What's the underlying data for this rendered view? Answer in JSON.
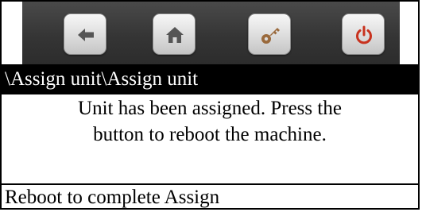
{
  "toolbar": {
    "buttons": [
      {
        "icon": "back-arrow-icon"
      },
      {
        "icon": "home-icon"
      },
      {
        "icon": "key-icon"
      },
      {
        "icon": "power-icon"
      }
    ],
    "background_color": "#353535",
    "button_color": "#dcdcdc",
    "icon_color": "#555555",
    "key_icon_color": "#9a6a3c",
    "power_icon_color": "#c8321e"
  },
  "path": {
    "text": "\\Assign unit\\Assign unit",
    "background_color": "#000000",
    "text_color": "#ffffff"
  },
  "message": {
    "line1": "Unit has been assigned.  Press the",
    "line2": "button to reboot the machine."
  },
  "status": {
    "text": "Reboot to complete Assign"
  }
}
